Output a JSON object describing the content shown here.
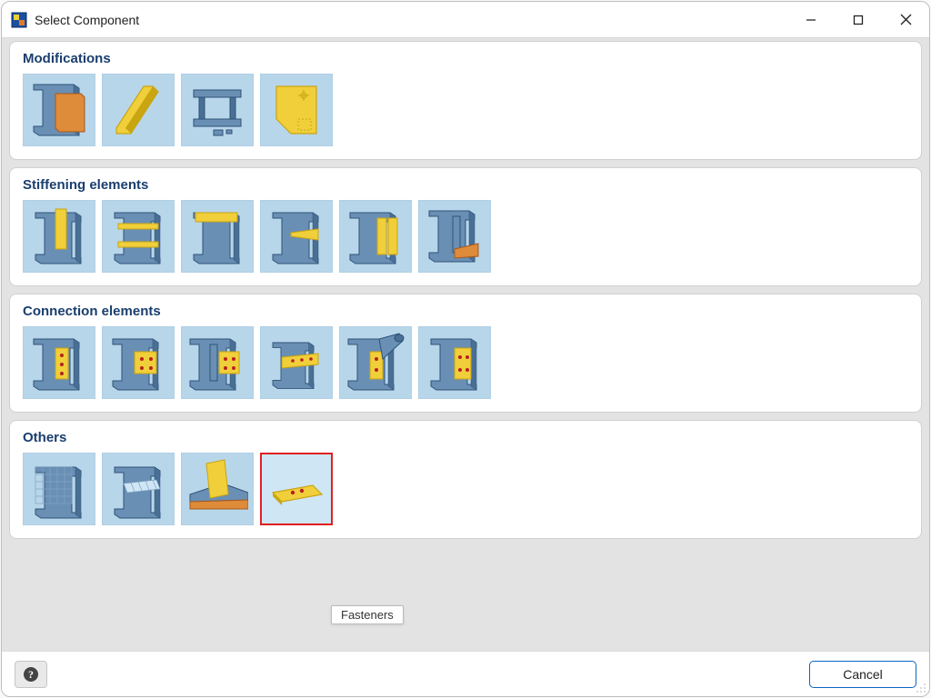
{
  "window": {
    "title": "Select Component"
  },
  "categories": [
    {
      "key": "modifications",
      "title": "Modifications",
      "items": [
        {
          "name": "modification-tile-1",
          "icon": "mod1"
        },
        {
          "name": "modification-tile-2",
          "icon": "mod2"
        },
        {
          "name": "modification-tile-3",
          "icon": "mod3"
        },
        {
          "name": "modification-tile-4",
          "icon": "mod4"
        }
      ]
    },
    {
      "key": "stiffening",
      "title": "Stiffening elements",
      "items": [
        {
          "name": "stiffening-tile-1",
          "icon": "stf1"
        },
        {
          "name": "stiffening-tile-2",
          "icon": "stf2"
        },
        {
          "name": "stiffening-tile-3",
          "icon": "stf3"
        },
        {
          "name": "stiffening-tile-4",
          "icon": "stf4"
        },
        {
          "name": "stiffening-tile-5",
          "icon": "stf5"
        },
        {
          "name": "stiffening-tile-6",
          "icon": "stf6"
        }
      ]
    },
    {
      "key": "connection",
      "title": "Connection elements",
      "items": [
        {
          "name": "connection-tile-1",
          "icon": "con1"
        },
        {
          "name": "connection-tile-2",
          "icon": "con2"
        },
        {
          "name": "connection-tile-3",
          "icon": "con3"
        },
        {
          "name": "connection-tile-4",
          "icon": "con4"
        },
        {
          "name": "connection-tile-5",
          "icon": "con5"
        },
        {
          "name": "connection-tile-6",
          "icon": "con6"
        }
      ]
    },
    {
      "key": "others",
      "title": "Others",
      "items": [
        {
          "name": "others-tile-1",
          "icon": "oth1"
        },
        {
          "name": "others-tile-2",
          "icon": "oth2"
        },
        {
          "name": "others-tile-3",
          "icon": "oth3"
        },
        {
          "name": "others-tile-fasteners",
          "icon": "oth4",
          "selected": true,
          "tooltip": "Fasteners"
        }
      ]
    }
  ],
  "footer": {
    "cancel_label": "Cancel"
  },
  "tooltip": {
    "text": "Fasteners"
  },
  "colors": {
    "steel_light": "#6a8fb4",
    "steel_mid": "#4a6f94",
    "steel_dark": "#2f5378",
    "gold": "#f0cf3a",
    "gold_dark": "#c9a512",
    "orange": "#de8b3a",
    "red_dot": "#b82020"
  }
}
